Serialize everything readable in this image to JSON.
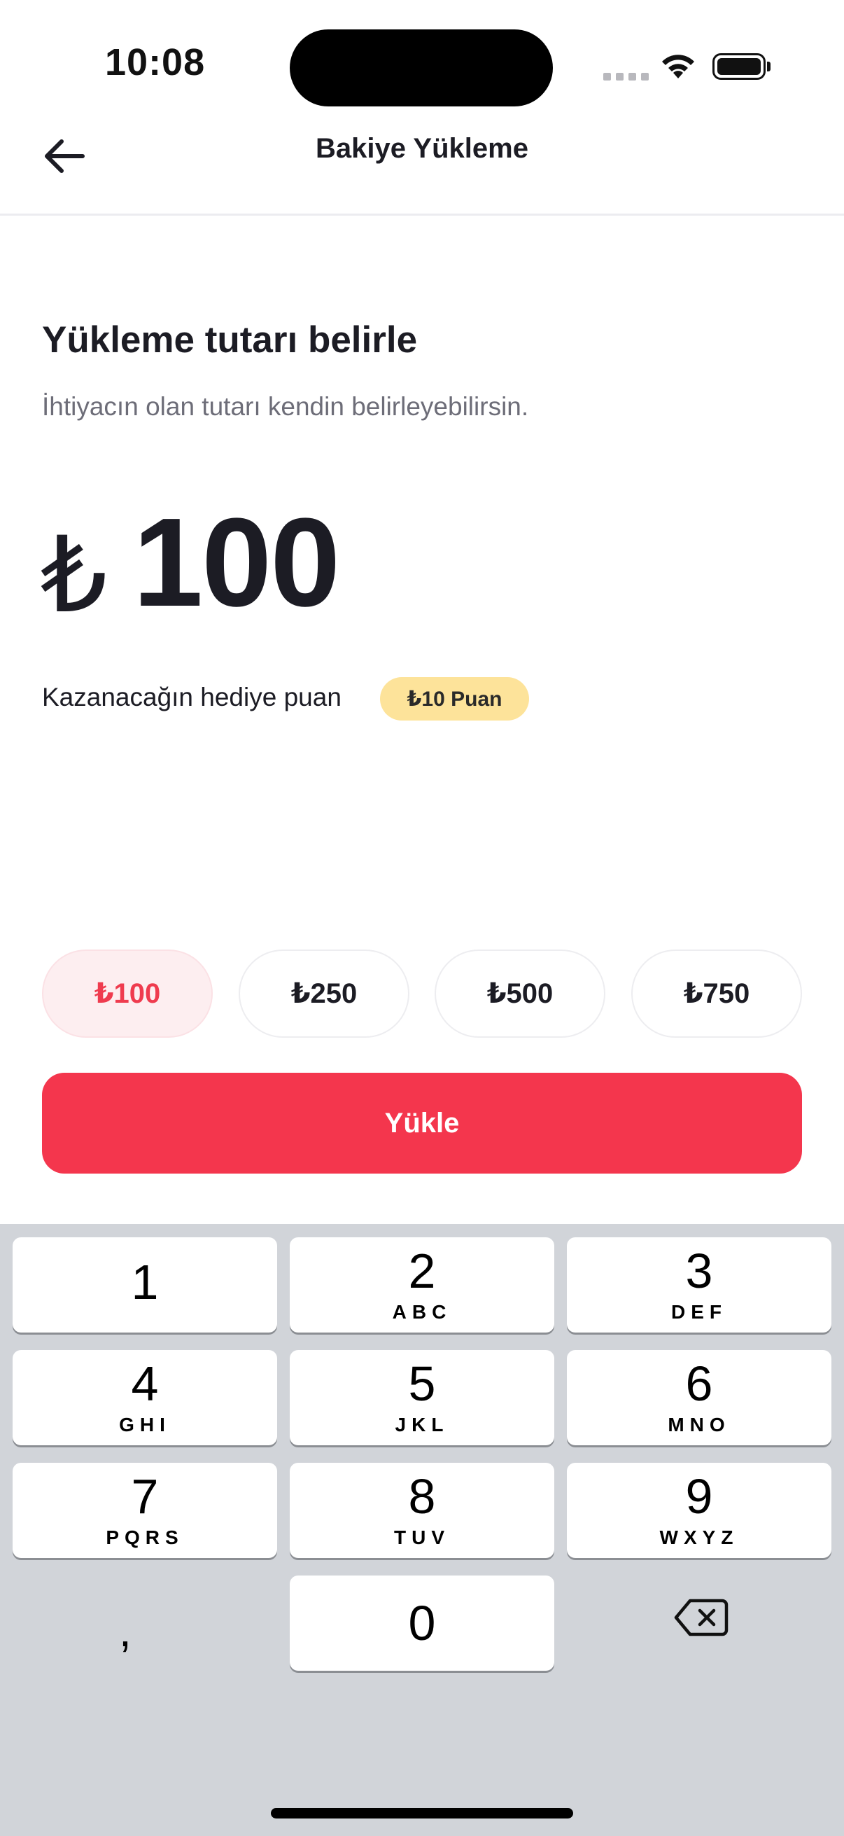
{
  "status_bar": {
    "time": "10:08"
  },
  "header": {
    "title": "Bakiye Yükleme"
  },
  "main": {
    "title": "Yükleme tutarı belirle",
    "subtitle": "İhtiyacın olan tutarı kendin belirleyebilirsin.",
    "currency_symbol": "₺",
    "amount": "100",
    "points_label": "Kazanacağın hediye puan",
    "points_badge": "₺10 Puan"
  },
  "quick_amounts": [
    {
      "label": "₺100",
      "selected": true
    },
    {
      "label": "₺250",
      "selected": false
    },
    {
      "label": "₺500",
      "selected": false
    },
    {
      "label": "₺750",
      "selected": false
    }
  ],
  "load_button": {
    "label": "Yükle"
  },
  "keyboard": {
    "keys": [
      {
        "num": "1",
        "letters": ""
      },
      {
        "num": "2",
        "letters": "ABC"
      },
      {
        "num": "3",
        "letters": "DEF"
      },
      {
        "num": "4",
        "letters": "GHI"
      },
      {
        "num": "5",
        "letters": "JKL"
      },
      {
        "num": "6",
        "letters": "MNO"
      },
      {
        "num": "7",
        "letters": "PQRS"
      },
      {
        "num": "8",
        "letters": "TUV"
      },
      {
        "num": "9",
        "letters": "WXYZ"
      },
      {
        "num": "0",
        "letters": ""
      }
    ],
    "comma": ","
  },
  "colors": {
    "accent": "#f4364d",
    "chip_selected_bg": "#fdeef0",
    "badge_bg": "#fde39a",
    "keyboard_bg": "#d1d4d9"
  }
}
